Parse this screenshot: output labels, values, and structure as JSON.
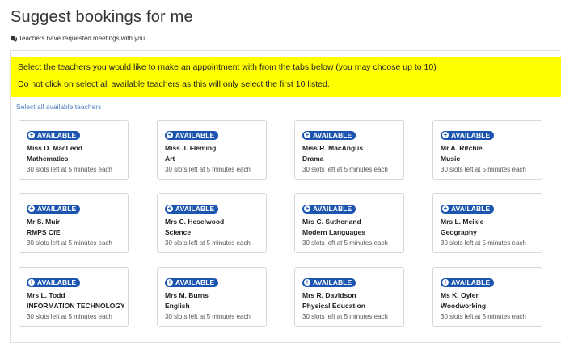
{
  "page": {
    "title": "Suggest bookings for me",
    "subtitle": "Teachers have requested meetings with you."
  },
  "notice": {
    "line1": "Select the teachers you would like to make an appointment with from the tabs below (you may choose up to 10)",
    "line2": "Do not click on select all available teachers as this will only select the first 10 listed."
  },
  "select_all_label": "Select all available teachers",
  "colors": {
    "badge": "#1c55b0",
    "notice_bg": "#ffff00",
    "link": "#4a7ec2"
  },
  "teachers": [
    {
      "status": "AVAILABLE",
      "name": "Miss D. MacLeod",
      "subject": "Mathematics",
      "slots": "30 slots left at 5 minutes each"
    },
    {
      "status": "AVAILABLE",
      "name": "Miss J. Fleming",
      "subject": "Art",
      "slots": "30 slots left at 5 minutes each"
    },
    {
      "status": "AVAILABLE",
      "name": "Miss R. MacAngus",
      "subject": "Drama",
      "slots": "30 slots left at 5 minutes each"
    },
    {
      "status": "AVAILABLE",
      "name": "Mr A. Ritchie",
      "subject": "Music",
      "slots": "30 slots left at 5 minutes each"
    },
    {
      "status": "AVAILABLE",
      "name": "Mr S. Muir",
      "subject": "RMPS CfE",
      "slots": "30 slots left at 5 minutes each"
    },
    {
      "status": "AVAILABLE",
      "name": "Mrs C. Heselwood",
      "subject": "Science",
      "slots": "30 slots left at 5 minutes each"
    },
    {
      "status": "AVAILABLE",
      "name": "Mrs C. Sutherland",
      "subject": "Modern Languages",
      "slots": "30 slots left at 5 minutes each"
    },
    {
      "status": "AVAILABLE",
      "name": "Mrs L. Meikle",
      "subject": "Geography",
      "slots": "30 slots left at 5 minutes each"
    },
    {
      "status": "AVAILABLE",
      "name": "Mrs L. Todd",
      "subject": "INFORMATION TECHNOLOGY",
      "slots": "30 slots left at 5 minutes each"
    },
    {
      "status": "AVAILABLE",
      "name": "Mrs M. Burns",
      "subject": "English",
      "slots": "30 slots left at 5 minutes each"
    },
    {
      "status": "AVAILABLE",
      "name": "Mrs R. Davidson",
      "subject": "Physical Education",
      "slots": "30 slots left at 5 minutes each"
    },
    {
      "status": "AVAILABLE",
      "name": "Ms K. Oyler",
      "subject": "Woodworking",
      "slots": "30 slots left at 5 minutes each"
    }
  ]
}
